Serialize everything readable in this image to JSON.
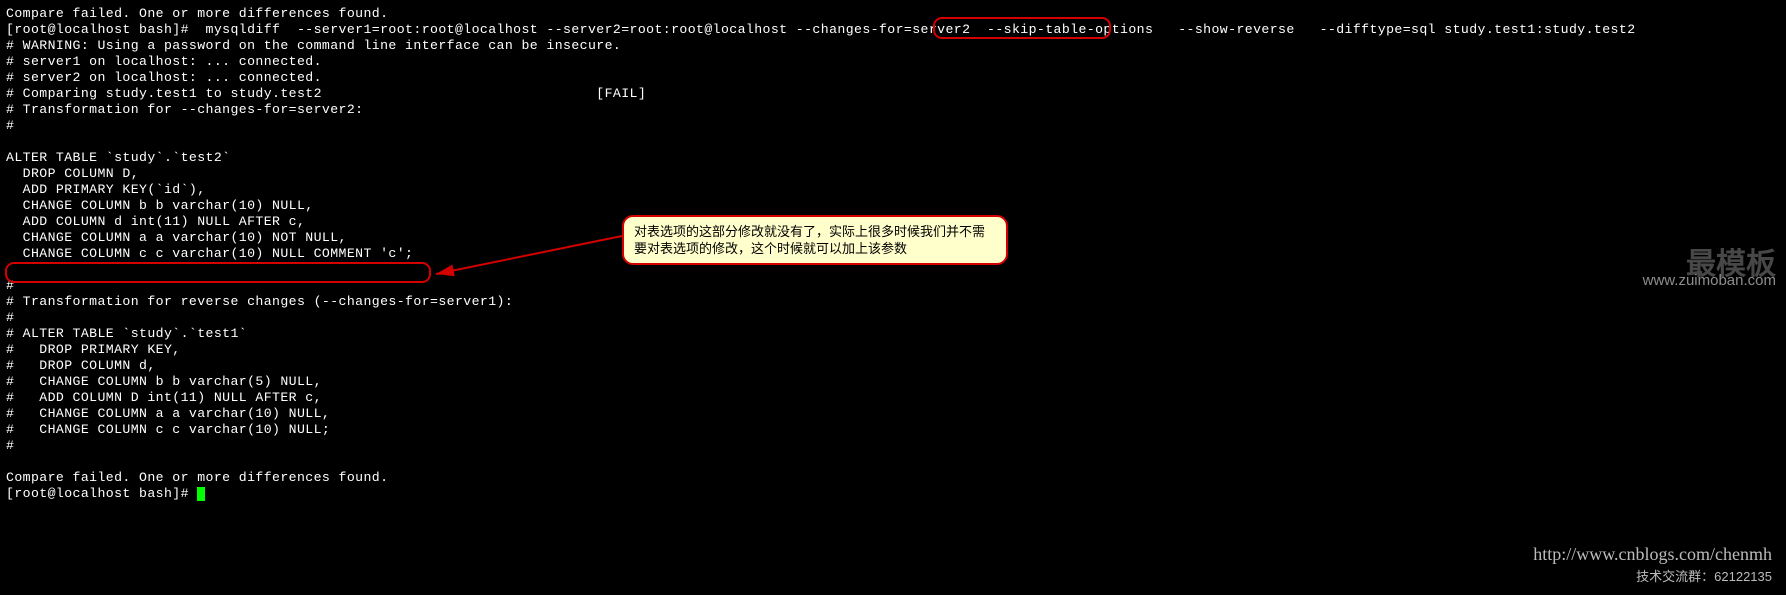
{
  "terminal": {
    "lines": [
      "Compare failed. One or more differences found.",
      "[root@localhost bash]#  mysqldiff  --server1=root:root@localhost --server2=root:root@localhost --changes-for=server2  --skip-table-options   --show-reverse   --difftype=sql study.test1:study.test2",
      "# WARNING: Using a password on the command line interface can be insecure.",
      "# server1 on localhost: ... connected.",
      "# server2 on localhost: ... connected.",
      "# Comparing study.test1 to study.test2                                 [FAIL]",
      "# Transformation for --changes-for=server2:",
      "#",
      "",
      "ALTER TABLE `study`.`test2`",
      "  DROP COLUMN D,",
      "  ADD PRIMARY KEY(`id`),",
      "  CHANGE COLUMN b b varchar(10) NULL,",
      "  ADD COLUMN d int(11) NULL AFTER c,",
      "  CHANGE COLUMN a a varchar(10) NOT NULL,",
      "  CHANGE COLUMN c c varchar(10) NULL COMMENT 'c';",
      "",
      "#",
      "# Transformation for reverse changes (--changes-for=server1):",
      "#",
      "# ALTER TABLE `study`.`test1`",
      "#   DROP PRIMARY KEY,",
      "#   DROP COLUMN d,",
      "#   CHANGE COLUMN b b varchar(5) NULL,",
      "#   ADD COLUMN D int(11) NULL AFTER c,",
      "#   CHANGE COLUMN a a varchar(10) NULL,",
      "#   CHANGE COLUMN c c varchar(10) NULL;",
      "#",
      "",
      "Compare failed. One or more differences found.",
      "[root@localhost bash]# "
    ]
  },
  "annotation": {
    "text": "对表选项的这部分修改就没有了，实际上很多时候我们并不需要对表选项的修改，这个时候就可以加上该参数"
  },
  "watermark": {
    "brand_cn": "最模板",
    "brand_url": "www.zuimoban.com",
    "blog_url": "http://www.cnblogs.com/chenmh",
    "qq_group": "技术交流群：62122135"
  }
}
